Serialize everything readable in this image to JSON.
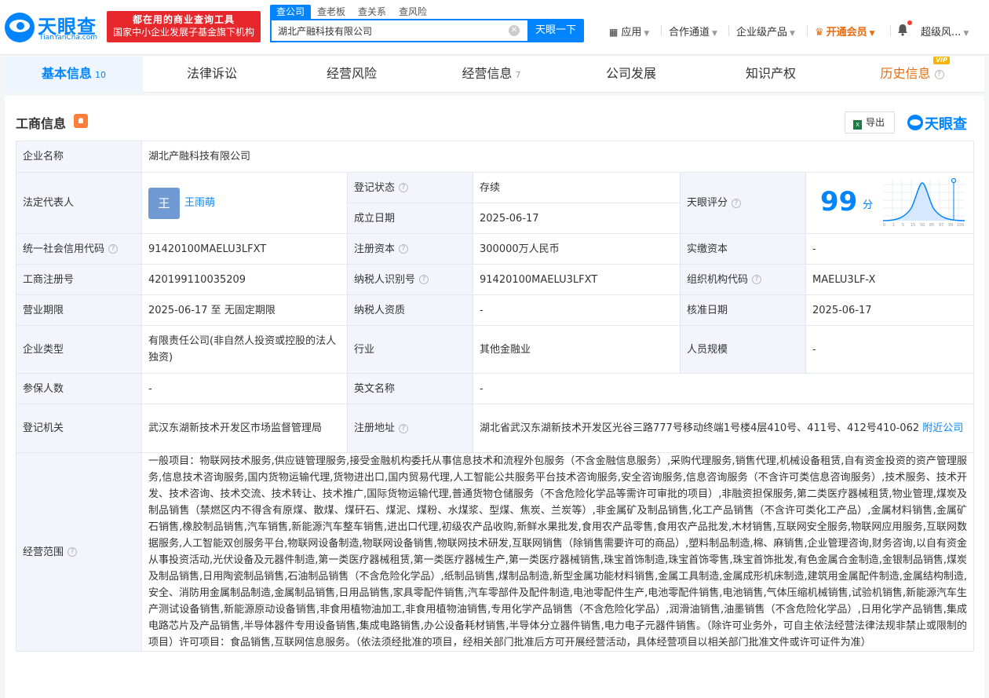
{
  "header": {
    "logo_text": "天眼查",
    "logo_sub": "TianYanCha.com",
    "slogan_line1": "都在用的商业查询工具",
    "slogan_line2": "国家中小企业发展子基金旗下机构",
    "search_tabs": [
      "查公司",
      "查老板",
      "查关系",
      "查风险"
    ],
    "search_value": "湖北产融科技有限公司",
    "search_button": "天眼一下",
    "nav": {
      "apps": "应用",
      "channel": "合作通道",
      "enterprise": "企业级产品",
      "vip": "开通会员",
      "user": "超级风..."
    }
  },
  "tabs": [
    {
      "label": "基本信息",
      "count": "10"
    },
    {
      "label": "法律诉讼",
      "count": ""
    },
    {
      "label": "经营风险",
      "count": ""
    },
    {
      "label": "经营信息",
      "count": "7"
    },
    {
      "label": "公司发展",
      "count": ""
    },
    {
      "label": "知识产权",
      "count": ""
    },
    {
      "label": "历史信息",
      "count": "",
      "badge": "VIP"
    }
  ],
  "section": {
    "title": "工商信息",
    "export": "导出",
    "brand": "天眼查"
  },
  "info": {
    "company_name_label": "企业名称",
    "company_name": "湖北产融科技有限公司",
    "legal_rep_label": "法定代表人",
    "legal_rep_avatar": "王",
    "legal_rep": "王雨萌",
    "reg_status_label": "登记状态",
    "reg_status": "存续",
    "founded_label": "成立日期",
    "founded": "2025-06-17",
    "score_label": "天眼评分",
    "score": "99",
    "score_unit": "分",
    "score_ticks": [
      "0",
      "1",
      "5",
      "15",
      "50",
      "85",
      "97",
      "99",
      "100"
    ],
    "credit_code_label": "统一社会信用代码",
    "credit_code": "91420100MAELU3LFXT",
    "reg_capital_label": "注册资本",
    "reg_capital": "300000万人民币",
    "paid_capital_label": "实缴资本",
    "paid_capital": "-",
    "reg_no_label": "工商注册号",
    "reg_no": "420199110035209",
    "taxpayer_id_label": "纳税人识别号",
    "taxpayer_id": "91420100MAELU3LFXT",
    "org_code_label": "组织机构代码",
    "org_code": "MAELU3LF-X",
    "term_label": "营业期限",
    "term": "2025-06-17 至 无固定期限",
    "taxpayer_qual_label": "纳税人资质",
    "taxpayer_qual": "-",
    "approval_date_label": "核准日期",
    "approval_date": "2025-06-17",
    "company_type_label": "企业类型",
    "company_type": "有限责任公司(非自然人投资或控股的法人独资)",
    "industry_label": "行业",
    "industry": "其他金融业",
    "staff_size_label": "人员规模",
    "staff_size": "-",
    "insured_label": "参保人数",
    "insured": "-",
    "english_name_label": "英文名称",
    "english_name": "-",
    "authority_label": "登记机关",
    "authority": "武汉东湖新技术开发区市场监督管理局",
    "address_label": "注册地址",
    "address": "湖北省武汉东湖新技术开发区光谷三路777号移动终端1号楼4层410号、411号、412号410-062",
    "nearby": "附近公司",
    "scope_label": "经营范围",
    "scope": "一般项目：物联网技术服务,供应链管理服务,接受金融机构委托从事信息技术和流程外包服务（不含金融信息服务）,采购代理服务,销售代理,机械设备租赁,自有资金投资的资产管理服务,信息技术咨询服务,国内货物运输代理,货物进出口,国内贸易代理,人工智能公共服务平台技术咨询服务,安全咨询服务,信息咨询服务（不含许可类信息咨询服务）,技术服务、技术开发、技术咨询、技术交流、技术转让、技术推广,国际货物运输代理,普通货物仓储服务（不含危险化学品等需许可审批的项目）,非融资担保服务,第二类医疗器械租赁,物业管理,煤炭及制品销售（禁燃区内不得含有原煤、散煤、煤矸石、煤泥、煤粉、水煤浆、型煤、焦炭、兰炭等）,非金属矿及制品销售,化工产品销售（不含许可类化工产品）,金属材料销售,金属矿石销售,橡胶制品销售,汽车销售,新能源汽车整车销售,进出口代理,初级农产品收购,新鲜水果批发,食用农产品零售,食用农产品批发,木材销售,互联网安全服务,物联网应用服务,互联网数据服务,人工智能双创服务平台,物联网设备制造,物联网设备销售,物联网技术研发,互联网销售（除销售需要许可的商品）,塑料制品制造,棉、麻销售,企业管理咨询,财务咨询,以自有资金从事投资活动,光伏设备及元器件制造,第一类医疗器械租赁,第一类医疗器械生产,第一类医疗器械销售,珠宝首饰制造,珠宝首饰零售,珠宝首饰批发,有色金属合金制造,金银制品销售,煤炭及制品销售,日用陶瓷制品销售,石油制品销售（不含危险化学品）,纸制品销售,煤制品制造,新型金属功能材料销售,金属工具制造,金属成形机床制造,建筑用金属配件制造,金属结构制造,安全、消防用金属制品制造,金属制品销售,日用品销售,家具零配件销售,汽车零部件及配件制造,电池零配件生产,电池零配件销售,电池销售,气体压缩机械销售,试验机销售,新能源汽车生产测试设备销售,新能源原动设备销售,非食用植物油加工,非食用植物油销售,专用化学产品销售（不含危险化学品）,润滑油销售,油墨销售（不含危险化学品）,日用化学产品销售,集成电路芯片及产品销售,半导体器件专用设备销售,集成电路销售,办公设备耗材销售,半导体分立器件销售,电力电子元器件销售。（除许可业务外，可自主依法经营法律法规非禁止或限制的项目）许可项目：食品销售,互联网信息服务。（依法须经批准的项目，经相关部门批准后方可开展经营活动，具体经营项目以相关部门批准文件或许可证件为准）"
  },
  "colors": {
    "brand_blue": "#0084ff",
    "label_bg": "#f2f6fc",
    "status_green": "#0d9c4a",
    "vip_orange": "#e96c0c",
    "slogan_red": "#e6282d"
  }
}
